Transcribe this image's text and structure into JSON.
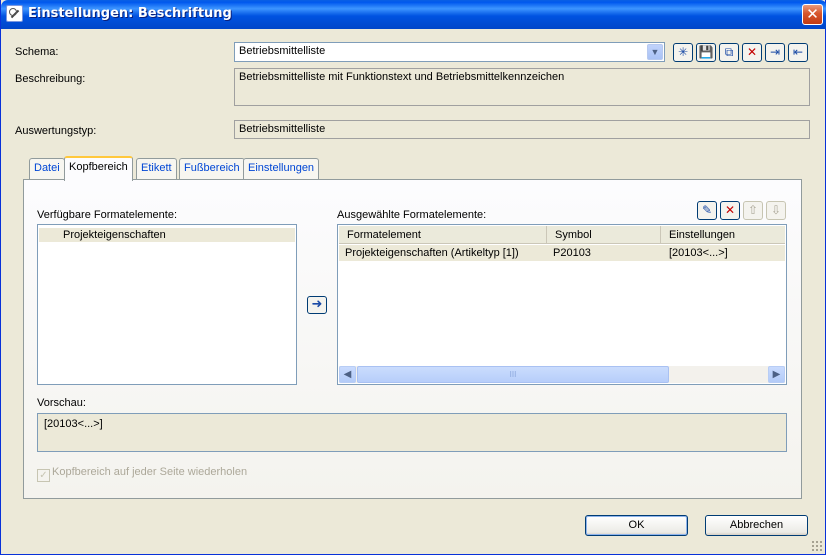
{
  "window": {
    "title": "Einstellungen: Beschriftung",
    "close_glyph": "✕"
  },
  "schema": {
    "label": "Schema:",
    "value": "Betriebsmittelliste"
  },
  "toolbar": {
    "icons": [
      "new-icon",
      "save-icon",
      "copy-icon",
      "delete-icon",
      "import-icon",
      "export-icon"
    ]
  },
  "beschreibung": {
    "label": "Beschreibung:",
    "value": "Betriebsmittelliste mit Funktionstext und Betriebsmittelkennzeichen"
  },
  "auswertungstyp": {
    "label": "Auswertungstyp:",
    "value": "Betriebsmittelliste"
  },
  "tabs": [
    {
      "label": "Datei",
      "active": false
    },
    {
      "label": "Kopfbereich",
      "active": true
    },
    {
      "label": "Etikett",
      "active": false
    },
    {
      "label": "Fußbereich",
      "active": false
    },
    {
      "label": "Einstellungen",
      "active": false
    }
  ],
  "available": {
    "label": "Verfügbare Formatelemente:",
    "items": [
      "Projekteigenschaften"
    ]
  },
  "selected": {
    "label": "Ausgewählte Formatelemente:",
    "columns": [
      "Formatelement",
      "Symbol",
      "Einstellungen"
    ],
    "rows": [
      {
        "formatelement": "Projekteigenschaften (Artikeltyp [1])",
        "symbol": "P20103",
        "einstellungen": "[20103<...>]"
      }
    ],
    "scroll_thumb_glyph": "III"
  },
  "preview": {
    "label": "Vorschau:",
    "value": "[20103<...>]"
  },
  "repeat_checkbox": {
    "label": "Kopfbereich auf jeder Seite wiederholen",
    "checked": true,
    "enabled": false
  },
  "buttons": {
    "ok": "OK",
    "cancel": "Abbrechen"
  },
  "colors": {
    "titlebar": "#0058ee",
    "dialog_bg": "#ece9d8",
    "link_tab": "#0046d5",
    "delete_red": "#c30000"
  }
}
